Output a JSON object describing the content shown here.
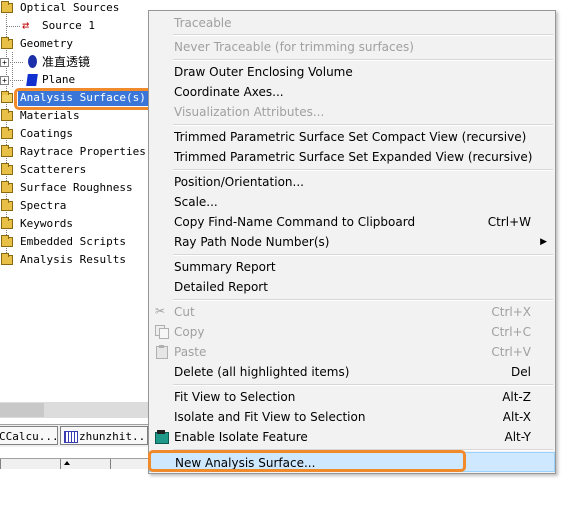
{
  "tree": {
    "items": [
      {
        "label": "Optical Sources",
        "icon": "folder-icon"
      },
      {
        "label": "Source 1",
        "icon": "source-arrow-icon"
      },
      {
        "label": "Geometry",
        "icon": "folder-icon"
      },
      {
        "label": "准直透镜",
        "icon": "lens-icon"
      },
      {
        "label": "Plane",
        "icon": "plane-icon"
      },
      {
        "label": "Analysis Surface(s)",
        "icon": "analysis-folder-icon"
      },
      {
        "label": "Materials",
        "icon": "folder-icon"
      },
      {
        "label": "Coatings",
        "icon": "folder-icon"
      },
      {
        "label": "Raytrace Properties",
        "icon": "folder-icon"
      },
      {
        "label": "Scatterers",
        "icon": "folder-icon"
      },
      {
        "label": "Surface Roughness",
        "icon": "folder-icon"
      },
      {
        "label": "Spectra",
        "icon": "folder-icon"
      },
      {
        "label": "Keywords",
        "icon": "folder-icon"
      },
      {
        "label": "Embedded Scripts",
        "icon": "folder-icon"
      },
      {
        "label": "Analysis Results",
        "icon": "folder-icon"
      }
    ]
  },
  "tabs": [
    "CCalcu...",
    "zhunzhit..."
  ],
  "menu": {
    "traceable": "Traceable",
    "never_traceable": "Never Traceable (for trimming surfaces)",
    "draw_outer": "Draw Outer Enclosing Volume",
    "coord_axes": "Coordinate Axes...",
    "vis_attr": "Visualization Attributes...",
    "compact_view": "Trimmed Parametric Surface Set Compact View (recursive)",
    "expanded_view": "Trimmed Parametric Surface Set Expanded View (recursive)",
    "position": "Position/Orientation...",
    "scale": "Scale...",
    "copy_find": "Copy Find-Name Command to Clipboard",
    "copy_find_sc": "Ctrl+W",
    "ray_path": "Ray Path Node Number(s)",
    "summary": "Summary Report",
    "detailed": "Detailed Report",
    "cut": "Cut",
    "cut_sc": "Ctrl+X",
    "copy": "Copy",
    "copy_sc": "Ctrl+C",
    "paste": "Paste",
    "paste_sc": "Ctrl+V",
    "delete": "Delete (all highlighted items)",
    "delete_sc": "Del",
    "fit_view": "Fit View to Selection",
    "fit_view_sc": "Alt-Z",
    "isolate_fit": "Isolate and Fit View to Selection",
    "isolate_fit_sc": "Alt-X",
    "enable_isolate": "Enable Isolate Feature",
    "enable_isolate_sc": "Alt-Y",
    "new_analysis": "New Analysis Surface..."
  },
  "colors": {
    "highlight_orange": "#f08a2a",
    "selection_blue": "#3a76d8",
    "menu_hover": "#cde8ff"
  }
}
